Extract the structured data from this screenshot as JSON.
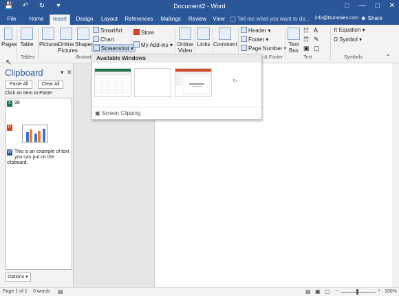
{
  "titlebar": {
    "title": "Document2 - Word",
    "qat": [
      "save-icon",
      "undo-icon",
      "redo-icon",
      "customize-icon"
    ],
    "window_buttons": [
      "restore-ribbon-icon",
      "minimize-icon",
      "maximize-icon",
      "close-icon"
    ]
  },
  "tabs": [
    "File",
    "Home",
    "Insert",
    "Design",
    "Layout",
    "References",
    "Mailings",
    "Review",
    "View"
  ],
  "active_tab": "Insert",
  "tellme": "Tell me what you want to do...",
  "account": "info@Dummies.com",
  "share": "Share",
  "ribbon": {
    "pages": "Pages",
    "table": "Table",
    "pictures": "Pictures",
    "online_pictures_1": "Online",
    "online_pictures_2": "Pictures",
    "shapes": "Shapes",
    "smartart": "SmartArt",
    "chart": "Chart",
    "screenshot": "Screenshot",
    "store": "Store",
    "my_addins": "My Add-ins",
    "online_video_1": "Online",
    "online_video_2": "Video",
    "links": "Links",
    "comment": "Comment",
    "header": "Header",
    "footer": "Footer",
    "page_number": "Page Number",
    "text_box_1": "Text",
    "text_box_2": "Box",
    "equation": "Equation",
    "symbol": "Symbol",
    "groups": {
      "tables": "Tables",
      "illustrations": "Illustratio",
      "header_footer": "r & Footer",
      "text": "Text",
      "symbols": "Symbols"
    }
  },
  "screenshot_dropdown": {
    "heading": "Available Windows",
    "screen_clipping": "Screen Clipping"
  },
  "clipboard": {
    "title": "Clipboard",
    "paste_all": "Paste All",
    "clear_all": "Clear All",
    "instruction": "Click an Item to Paste:",
    "items": [
      {
        "text": "98"
      },
      {
        "text": ""
      },
      {
        "text": "This is an example of text you can put on the clipboard."
      }
    ],
    "options": "Options"
  },
  "status": {
    "page": "Page 1 of 1",
    "words": "0 words",
    "zoom": "100%"
  }
}
